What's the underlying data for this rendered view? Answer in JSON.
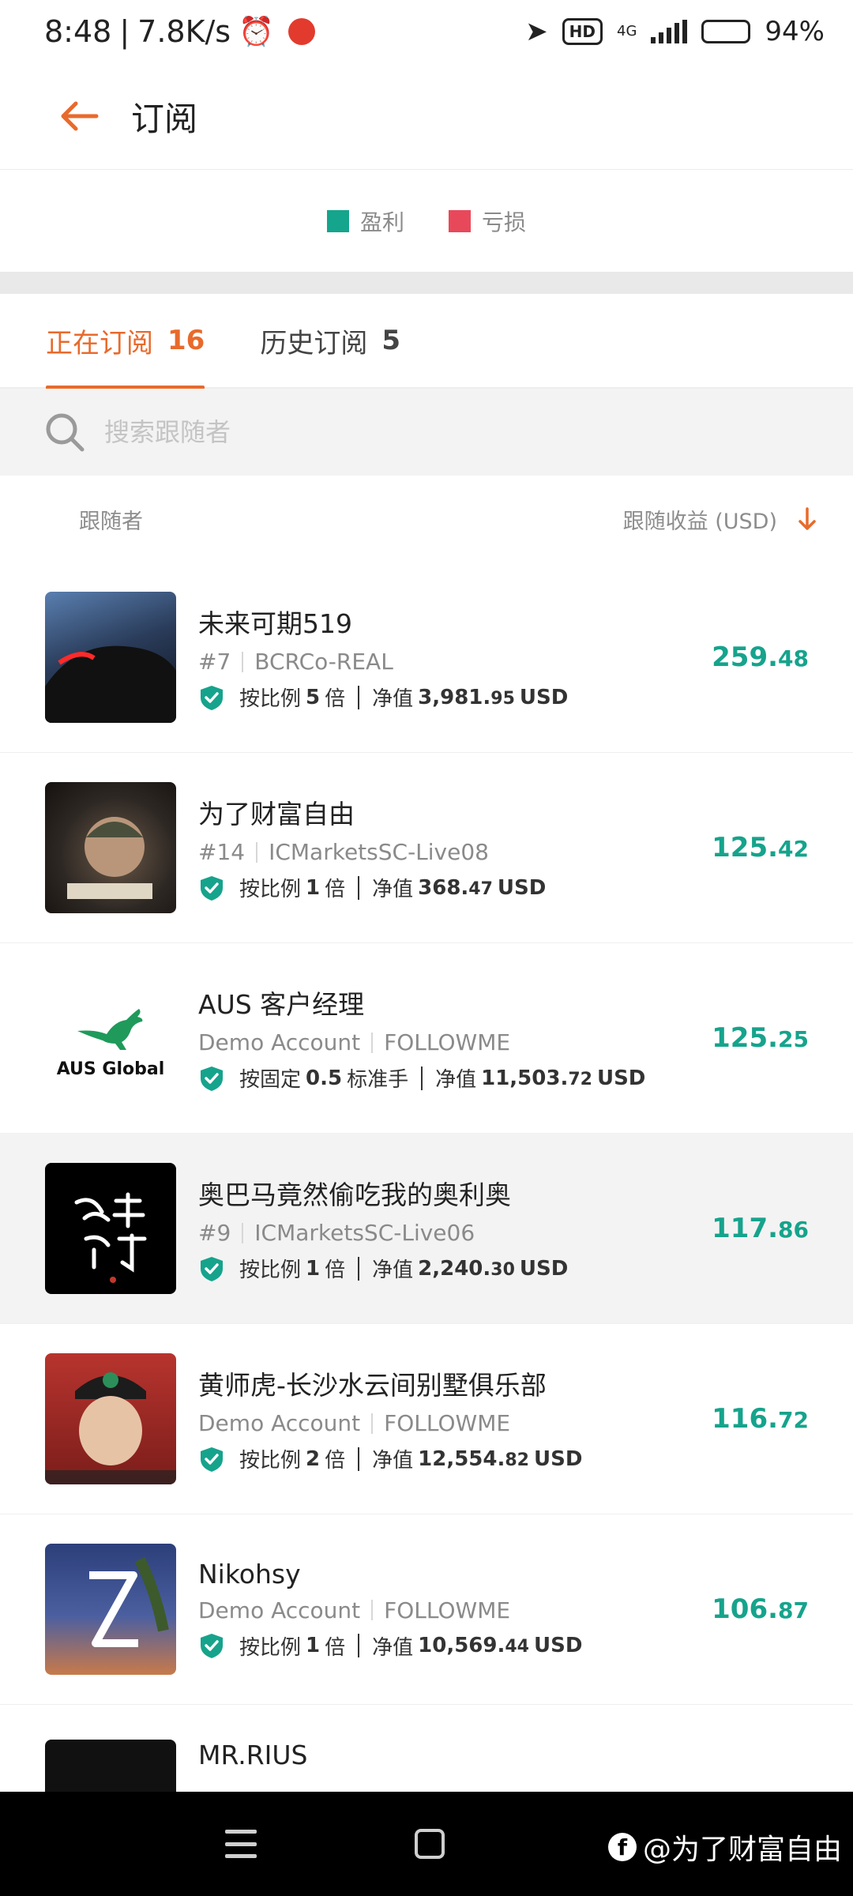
{
  "status_bar": {
    "time": "8:48",
    "speed": "7.8K/s",
    "hd": "HD",
    "network": "4G",
    "battery": "94%"
  },
  "header": {
    "title": "订阅"
  },
  "legend": {
    "profit_label": "盈利",
    "loss_label": "亏损",
    "profit_color": "#14a58c",
    "loss_color": "#e8495a"
  },
  "tabs": [
    {
      "label": "正在订阅",
      "count": "16"
    },
    {
      "label": "历史订阅",
      "count": "5"
    }
  ],
  "search": {
    "placeholder": "搜索跟随者"
  },
  "columns": {
    "follower": "跟随者",
    "profit": "跟随收益 (USD)"
  },
  "followers": [
    {
      "name": "未来可期519",
      "rank": "#7",
      "account": "BCRCo-REAL",
      "mode": "按比例",
      "multiplier": "5",
      "unit": "倍",
      "equity_label": "净值",
      "equity_int": "3,981.",
      "equity_dec": "95",
      "currency": "USD",
      "profit_int": "259.",
      "profit_dec": "48"
    },
    {
      "name": "为了财富自由",
      "rank": "#14",
      "account": "ICMarketsSC-Live08",
      "mode": "按比例",
      "multiplier": "1",
      "unit": "倍",
      "equity_label": "净值",
      "equity_int": "368.",
      "equity_dec": "47",
      "currency": "USD",
      "profit_int": "125.",
      "profit_dec": "42"
    },
    {
      "name": "AUS 客户经理",
      "rank": "Demo Account",
      "account": "FOLLOWME",
      "mode": "按固定",
      "multiplier": "0.5",
      "unit": "标准手",
      "equity_label": "净值",
      "equity_int": "11,503.",
      "equity_dec": "72",
      "currency": "USD",
      "profit_int": "125.",
      "profit_dec": "25",
      "logo_text": "AUS Global"
    },
    {
      "name": "奥巴马竟然偷吃我的奥利奥",
      "rank": "#9",
      "account": "ICMarketsSC-Live06",
      "mode": "按比例",
      "multiplier": "1",
      "unit": "倍",
      "equity_label": "净值",
      "equity_int": "2,240.",
      "equity_dec": "30",
      "currency": "USD",
      "profit_int": "117.",
      "profit_dec": "86"
    },
    {
      "name": "黄师虎-长沙水云间别墅俱乐部",
      "rank": "Demo Account",
      "account": "FOLLOWME",
      "mode": "按比例",
      "multiplier": "2",
      "unit": "倍",
      "equity_label": "净值",
      "equity_int": "12,554.",
      "equity_dec": "82",
      "currency": "USD",
      "profit_int": "116.",
      "profit_dec": "72"
    },
    {
      "name": "Nikohsy",
      "rank": "Demo Account",
      "account": "FOLLOWME",
      "mode": "按比例",
      "multiplier": "1",
      "unit": "倍",
      "equity_label": "净值",
      "equity_int": "10,569.",
      "equity_dec": "44",
      "currency": "USD",
      "profit_int": "106.",
      "profit_dec": "87"
    },
    {
      "name": "MR.RIUS"
    }
  ],
  "watermark": "@为了财富自由"
}
